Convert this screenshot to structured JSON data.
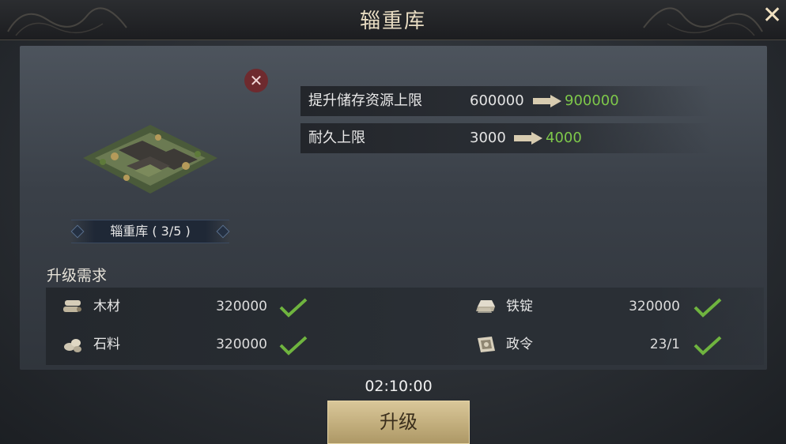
{
  "header": {
    "title": "辎重库",
    "close_icon": "close-x-icon"
  },
  "building": {
    "name_label": "辎重库 ( 3/5 )",
    "image_icon": "warehouse-building-icon",
    "remove_icon": "remove-x-icon"
  },
  "stats": [
    {
      "label": "提升储存资源上限",
      "old": "600000",
      "new": "900000"
    },
    {
      "label": "耐久上限",
      "old": "3000",
      "new": "4000"
    }
  ],
  "requirements": {
    "title": "升级需求",
    "items": [
      {
        "icon": "wood-icon",
        "name": "木材",
        "amount": "320000",
        "met": true
      },
      {
        "icon": "stone-icon",
        "name": "石料",
        "amount": "320000",
        "met": true
      },
      {
        "icon": "iron-ingot-icon",
        "name": "铁锭",
        "amount": "320000",
        "met": true
      },
      {
        "icon": "decree-icon",
        "name": "政令",
        "amount": "23/1",
        "met": true
      }
    ]
  },
  "timer": "02:10:00",
  "upgrade_button": "升级",
  "colors": {
    "increase": "#7ec84a",
    "check": "#6fb43f",
    "button": "#c4b07f"
  }
}
